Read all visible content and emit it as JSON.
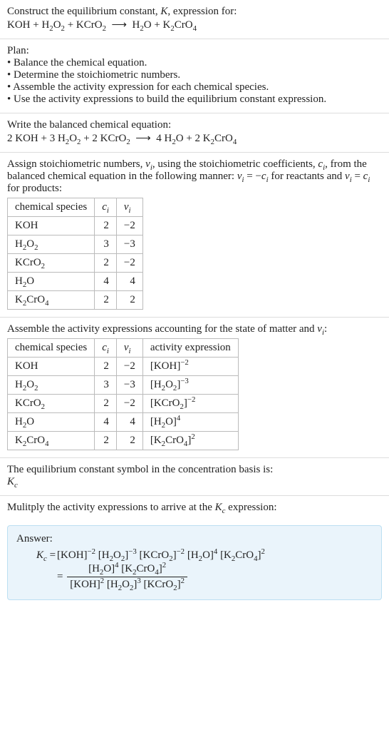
{
  "intro": {
    "line1": "Construct the equilibrium constant, K, expression for:",
    "equation": "KOH + H₂O₂ + KCrO₂ ⟶ H₂O + K₂CrO₄"
  },
  "plan": {
    "title": "Plan:",
    "items": [
      "• Balance the chemical equation.",
      "• Determine the stoichiometric numbers.",
      "• Assemble the activity expression for each chemical species.",
      "• Use the activity expressions to build the equilibrium constant expression."
    ]
  },
  "balanced": {
    "line1": "Write the balanced chemical equation:",
    "equation": "2 KOH + 3 H₂O₂ + 2 KCrO₂ ⟶ 4 H₂O + 2 K₂CrO₄"
  },
  "stoich_text": {
    "part1": "Assign stoichiometric numbers, νᵢ, using the stoichiometric coefficients, cᵢ, from the balanced chemical equation in the following manner: νᵢ = −cᵢ for reactants and νᵢ = cᵢ for products:"
  },
  "table1": {
    "headers": [
      "chemical species",
      "cᵢ",
      "νᵢ"
    ],
    "rows": [
      {
        "species": "KOH",
        "c": "2",
        "v": "−2"
      },
      {
        "species": "H₂O₂",
        "c": "3",
        "v": "−3"
      },
      {
        "species": "KCrO₂",
        "c": "2",
        "v": "−2"
      },
      {
        "species": "H₂O",
        "c": "4",
        "v": "4"
      },
      {
        "species": "K₂CrO₄",
        "c": "2",
        "v": "2"
      }
    ]
  },
  "activity_text": "Assemble the activity expressions accounting for the state of matter and νᵢ:",
  "table2": {
    "headers": [
      "chemical species",
      "cᵢ",
      "νᵢ",
      "activity expression"
    ],
    "rows": [
      {
        "species": "KOH",
        "c": "2",
        "v": "−2",
        "act": "[KOH]⁻²"
      },
      {
        "species": "H₂O₂",
        "c": "3",
        "v": "−3",
        "act": "[H₂O₂]⁻³"
      },
      {
        "species": "KCrO₂",
        "c": "2",
        "v": "−2",
        "act": "[KCrO₂]⁻²"
      },
      {
        "species": "H₂O",
        "c": "4",
        "v": "4",
        "act": "[H₂O]⁴"
      },
      {
        "species": "K₂CrO₄",
        "c": "2",
        "v": "2",
        "act": "[K₂CrO₄]²"
      }
    ]
  },
  "symboltext": {
    "line1": "The equilibrium constant symbol in the concentration basis is:",
    "symbol": "K𝒸"
  },
  "multiplytext": "Mulitply the activity expressions to arrive at the K𝒸 expression:",
  "answer": {
    "label": "Answer:",
    "lhs": "K𝒸 = ",
    "rhs1": "[KOH]⁻² [H₂O₂]⁻³ [KCrO₂]⁻² [H₂O]⁴ [K₂CrO₄]²",
    "eq2": "= ",
    "numerator": "[H₂O]⁴ [K₂CrO₄]²",
    "denominator": "[KOH]² [H₂O₂]³ [KCrO₂]²"
  },
  "chart_data": {
    "type": "table",
    "tables": [
      {
        "title": "Stoichiometric numbers",
        "columns": [
          "chemical species",
          "c_i",
          "ν_i"
        ],
        "rows": [
          [
            "KOH",
            2,
            -2
          ],
          [
            "H2O2",
            3,
            -3
          ],
          [
            "KCrO2",
            2,
            -2
          ],
          [
            "H2O",
            4,
            4
          ],
          [
            "K2CrO4",
            2,
            2
          ]
        ]
      },
      {
        "title": "Activity expressions",
        "columns": [
          "chemical species",
          "c_i",
          "ν_i",
          "activity expression"
        ],
        "rows": [
          [
            "KOH",
            2,
            -2,
            "[KOH]^-2"
          ],
          [
            "H2O2",
            3,
            -3,
            "[H2O2]^-3"
          ],
          [
            "KCrO2",
            2,
            -2,
            "[KCrO2]^-2"
          ],
          [
            "H2O",
            4,
            4,
            "[H2O]^4"
          ],
          [
            "K2CrO4",
            2,
            2,
            "[K2CrO4]^2"
          ]
        ]
      }
    ]
  }
}
